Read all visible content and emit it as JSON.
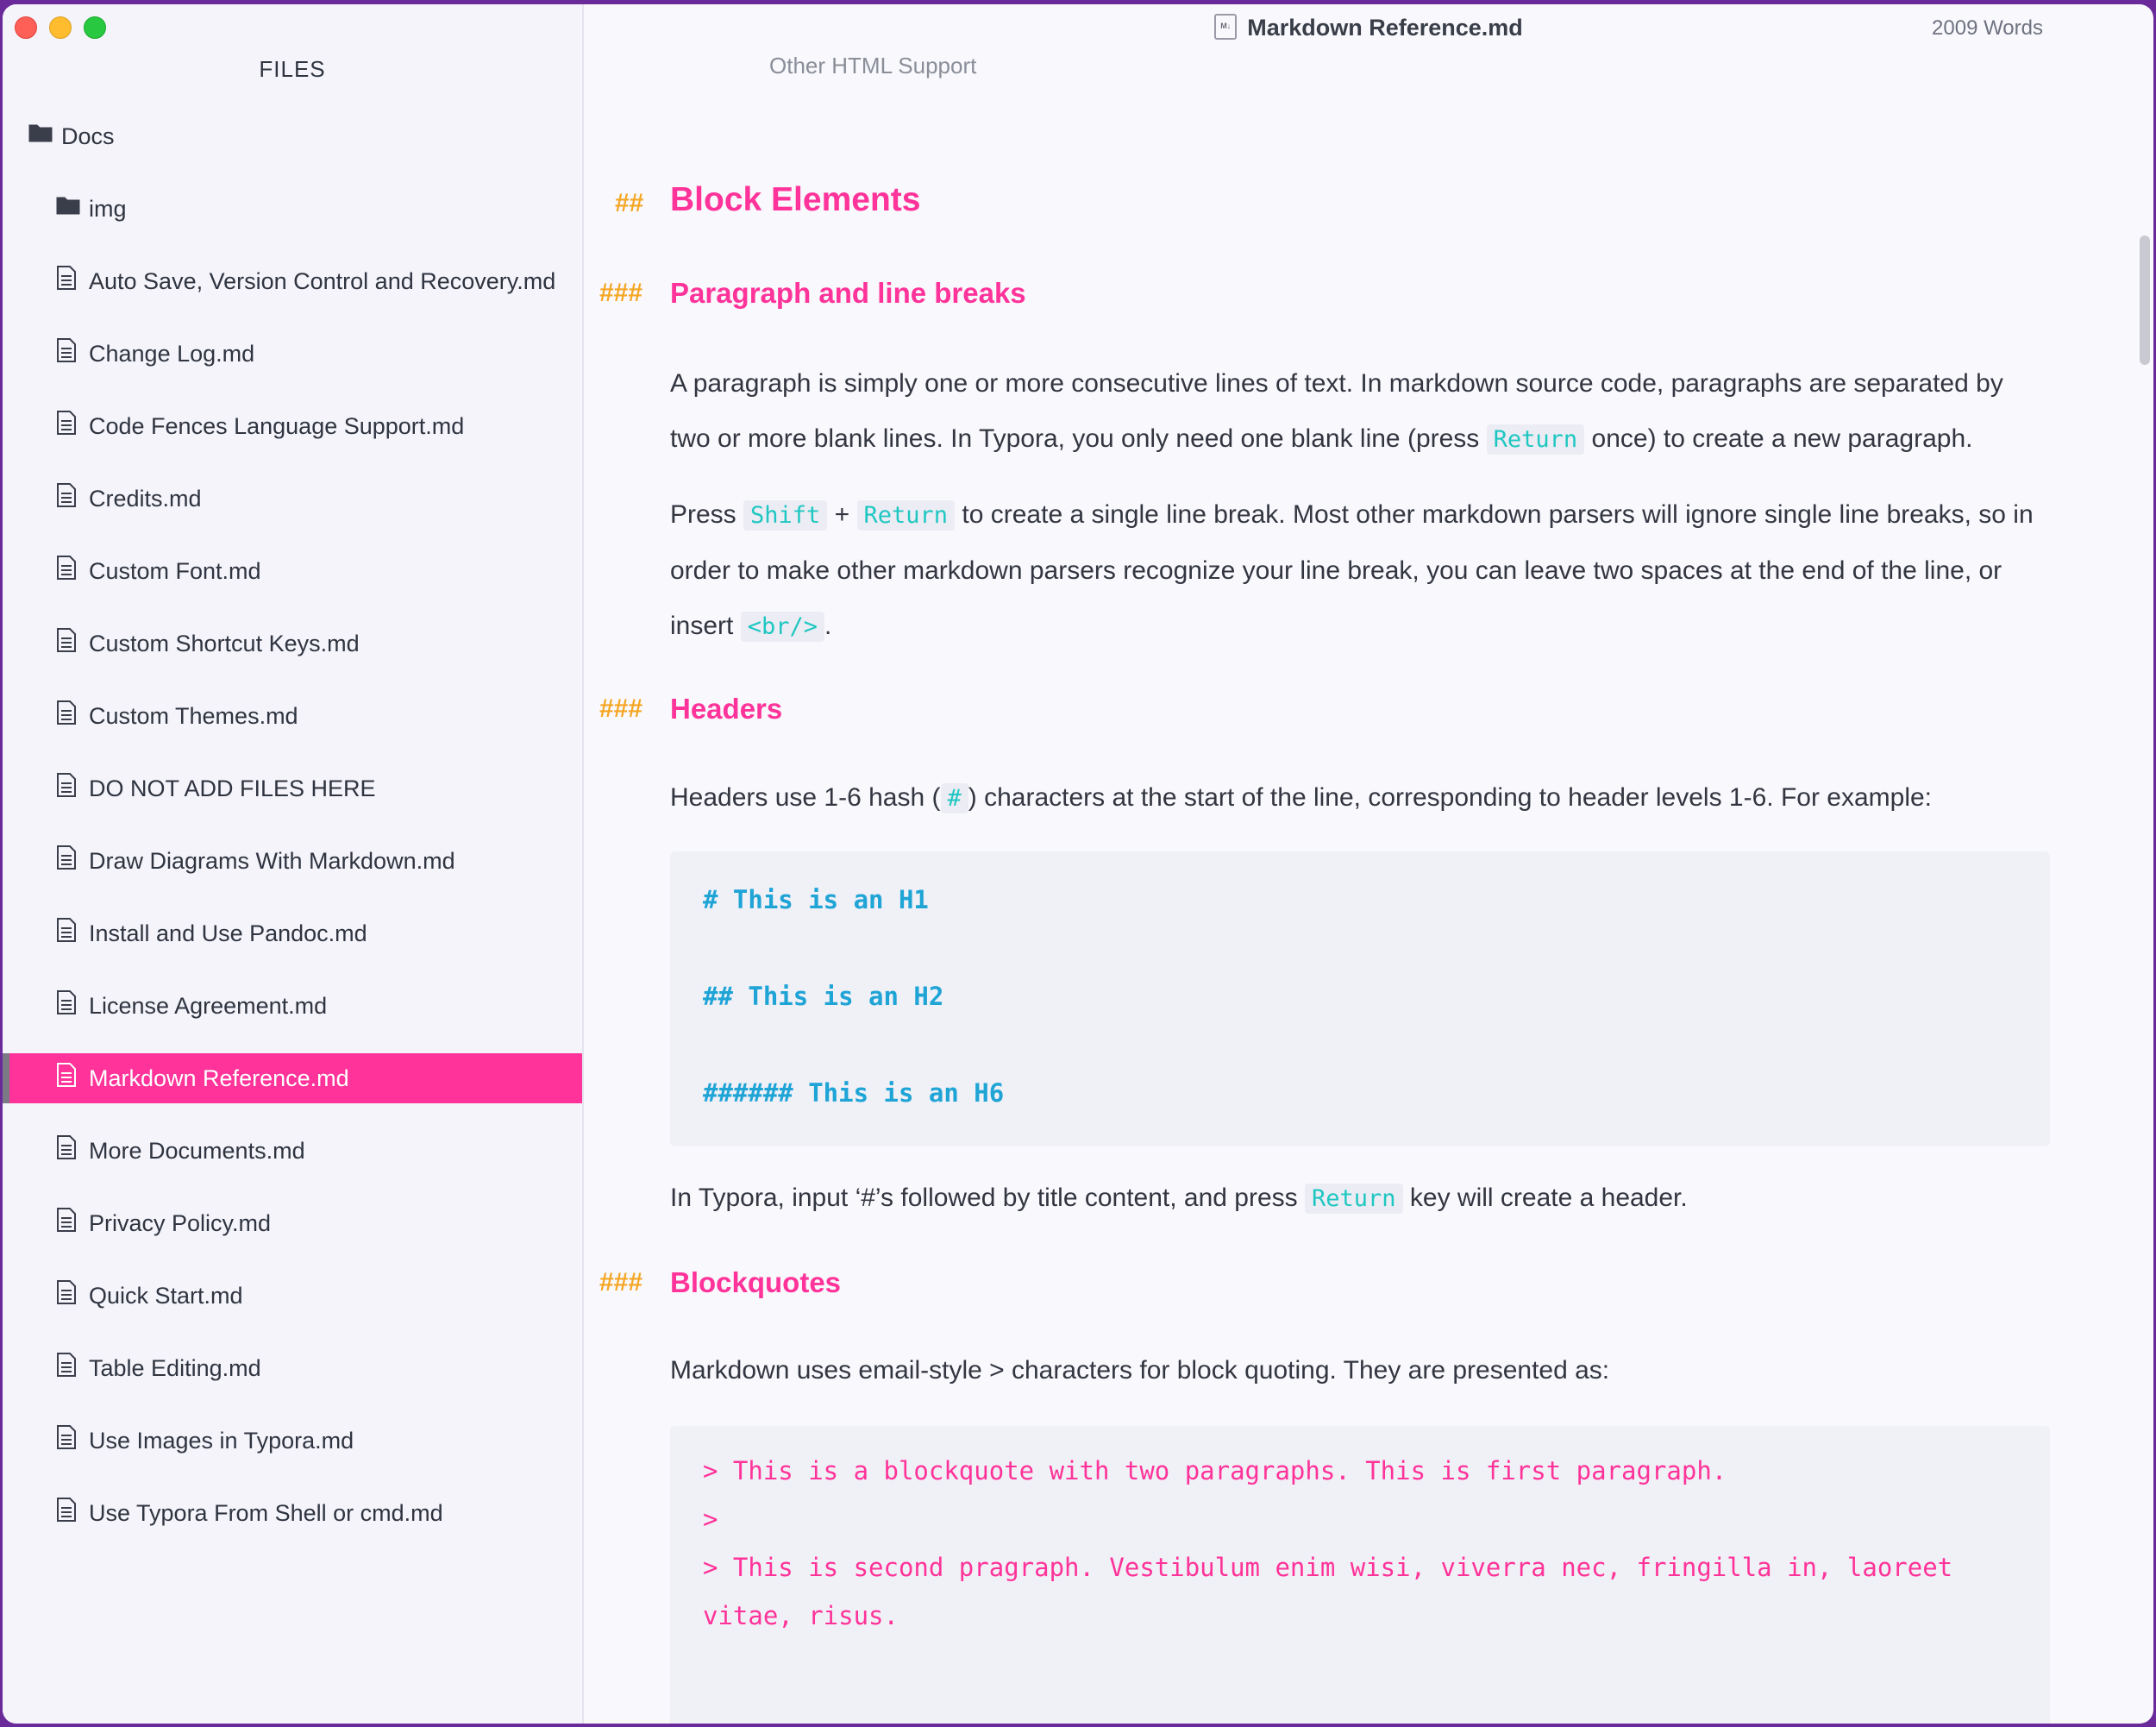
{
  "sidebar": {
    "title": "FILES",
    "root_folder": "Docs",
    "items": [
      {
        "label": "img",
        "type": "folder"
      },
      {
        "label": "Auto Save, Version Control and Recovery.md",
        "type": "file"
      },
      {
        "label": "Change Log.md",
        "type": "file"
      },
      {
        "label": "Code Fences Language Support.md",
        "type": "file"
      },
      {
        "label": "Credits.md",
        "type": "file"
      },
      {
        "label": "Custom Font.md",
        "type": "file"
      },
      {
        "label": "Custom Shortcut Keys.md",
        "type": "file"
      },
      {
        "label": "Custom Themes.md",
        "type": "file"
      },
      {
        "label": "DO NOT ADD FILES HERE",
        "type": "file"
      },
      {
        "label": "Draw Diagrams With Markdown.md",
        "type": "file"
      },
      {
        "label": "Install and Use Pandoc.md",
        "type": "file"
      },
      {
        "label": "License Agreement.md",
        "type": "file"
      },
      {
        "label": "Markdown Reference.md",
        "type": "file",
        "active": true
      },
      {
        "label": "More Documents.md",
        "type": "file"
      },
      {
        "label": "Privacy Policy.md",
        "type": "file"
      },
      {
        "label": "Quick Start.md",
        "type": "file"
      },
      {
        "label": "Table Editing.md",
        "type": "file"
      },
      {
        "label": "Use Images in Typora.md",
        "type": "file"
      },
      {
        "label": "Use Typora From Shell or cmd.md",
        "type": "file"
      }
    ]
  },
  "header": {
    "doc_icon_text": "M↓",
    "doc_title": "Markdown Reference.md",
    "word_count": "2009 Words"
  },
  "toc_item": "Other HTML Support",
  "doc": {
    "h2_mark": "##",
    "h3_mark": "###",
    "block_elements": "Block Elements",
    "paragraph_heading": "Paragraph and line breaks",
    "p1_a": "A paragraph is simply one or more consecutive lines of text. In markdown source code, paragraphs are separated by two or more blank lines. In Typora, you only need one blank line (press ",
    "p1_code": "Return",
    "p1_b": " once) to create a new paragraph.",
    "p2_a": "Press ",
    "p2_code1": "Shift",
    "p2_plus": " + ",
    "p2_code2": "Return",
    "p2_b": " to create a single line break. Most other markdown parsers will ignore single line breaks, so in order to make other markdown parsers recognize your line break, you can leave two spaces at the end of the line, or insert ",
    "p2_code3": "<br/>",
    "p2_c": ".",
    "headers_heading": "Headers",
    "p3_a": "Headers use 1-6 hash (",
    "p3_code": "#",
    "p3_b": ") characters at the start of the line, corresponding to header levels 1-6. For example:",
    "code_h1": "# This is an H1",
    "code_h2": "## This is an H2",
    "code_h6": "###### This is an H6",
    "p4_a": "In Typora, input ‘#’s followed by title content, and press ",
    "p4_code": "Return",
    "p4_b": " key will create a header.",
    "blockquotes_heading": "Blockquotes",
    "p5": "Markdown uses email-style > characters for block quoting. They are presented as:",
    "quote_1": "> This is a blockquote with two paragraphs. This is first paragraph.",
    "quote_2": ">",
    "quote_3": "> This is second pragraph. Vestibulum enim wisi, viverra nec, fringilla in, laoreet",
    "quote_4": "vitae, risus."
  }
}
